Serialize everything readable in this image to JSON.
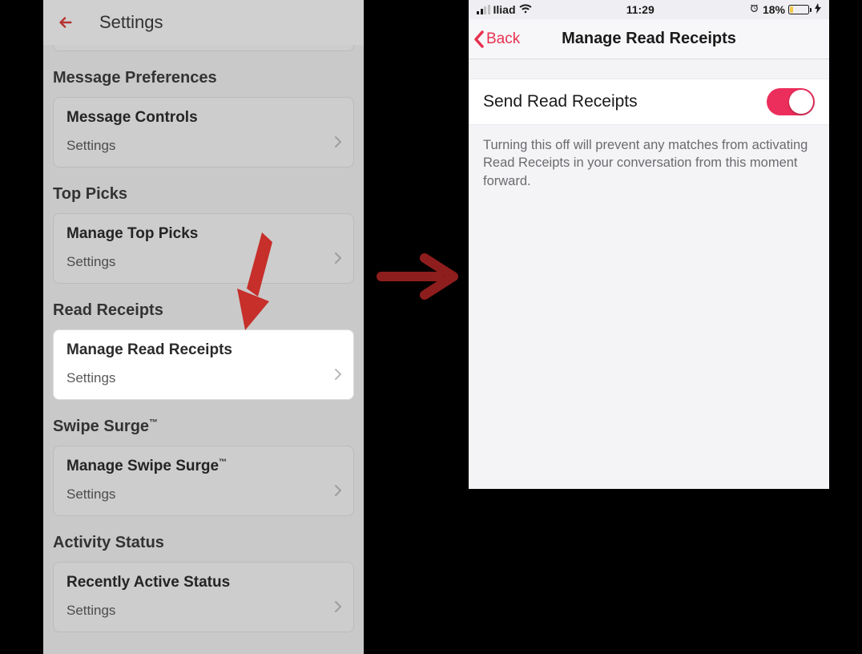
{
  "left": {
    "header_title": "Settings",
    "sections": [
      {
        "title": "Message Preferences",
        "card_title": "Message Controls",
        "card_sub": "Settings"
      },
      {
        "title": "Top Picks",
        "card_title": "Manage Top Picks",
        "card_sub": "Settings"
      },
      {
        "title": "Read Receipts",
        "card_title": "Manage Read Receipts",
        "card_sub": "Settings"
      },
      {
        "title_html": "Swipe Surge",
        "title_sup": "™",
        "card_title": "Manage Swipe Surge",
        "card_sup": "™",
        "card_sub": "Settings"
      },
      {
        "title": "Activity Status",
        "card_title": "Recently Active Status",
        "card_sub": "Settings"
      }
    ]
  },
  "right": {
    "status": {
      "carrier": "Iliad",
      "time": "11:29",
      "battery_pct": "18%"
    },
    "back_label": "Back",
    "nav_title": "Manage Read Receipts",
    "toggle_label": "Send Read Receipts",
    "description": "Turning this off will prevent any matches from activating Read Receipts in your conversation from this moment forward."
  }
}
